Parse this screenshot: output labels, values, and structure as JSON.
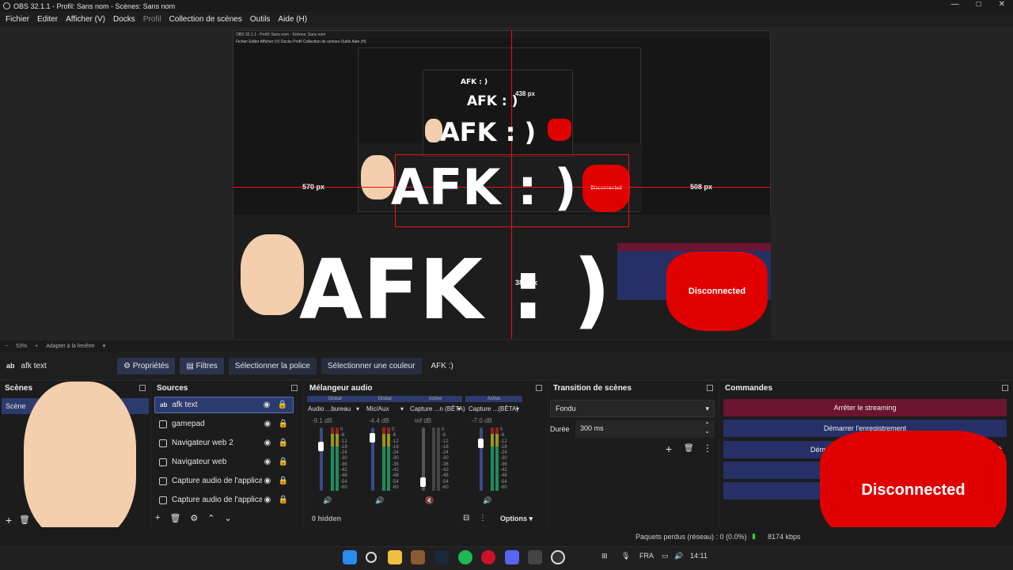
{
  "window": {
    "title": "OBS 32.1.1 - Profil: Sans nom - Scènes: Sans nom",
    "min": "—",
    "max": "□",
    "close": "✕"
  },
  "menu": [
    "Fichier",
    "Editer",
    "Afficher (V)",
    "Docks",
    "Profil",
    "Collection de scènes",
    "Outils",
    "Aide (H)"
  ],
  "preview": {
    "afk_text": "AFK : )",
    "guide_left": "570 px",
    "guide_right": "508 px",
    "guide_bottom": "386 px",
    "guide_top": "438 px",
    "gamepad_text": "Disconnected",
    "nested_title": "OBS 32.1.1 - Profil: Sans nom - Scènes: Sans nom",
    "nested_menu": "Fichier   Editer   Afficher (V)   Docks   Profil   Collection de scènes   Outils   Aide (H)"
  },
  "zoom": {
    "minus": "−",
    "value": "53%",
    "plus": "+",
    "fit": "Adapter à la fenêtre"
  },
  "source_toolbar": {
    "selected_name": "afk text",
    "properties": "Propriétés",
    "filters": "Filtres",
    "select_font": "Sélectionner la police",
    "select_color": "Sélectionner une couleur",
    "text_value": "AFK :)"
  },
  "scenes": {
    "title": "Scènes",
    "item": "Scène"
  },
  "sources": {
    "title": "Sources",
    "items": [
      "afk text",
      "gamepad",
      "Navigateur web 2",
      "Navigateur web",
      "Capture audio de l'applicatio",
      "Capture audio de l'applicatio"
    ]
  },
  "mixer": {
    "title": "Mélangeur audio",
    "tabs": [
      "Global",
      "Global",
      "Active",
      "Active"
    ],
    "channels": [
      {
        "name": "Audio ...bureau",
        "db": "-9.1 dB",
        "level": 0.75
      },
      {
        "name": "Mic/Aux",
        "db": "-4.4 dB",
        "level": 0.9
      },
      {
        "name": "Capture ...n (BÊTA)",
        "db": "-inf dB",
        "level": 0.1
      },
      {
        "name": "Capture ...(BÊTA)",
        "db": "-7.0 dB",
        "level": 0.8
      }
    ],
    "scale": [
      "0",
      "-6",
      "-12",
      "-18",
      "-24",
      "-30",
      "-36",
      "-42",
      "-48",
      "-54",
      "-60"
    ],
    "hidden": "0 hidden",
    "options": "Options"
  },
  "transition": {
    "title": "Transition de scènes",
    "type": "Fondu",
    "duration_label": "Durée",
    "duration": "300 ms"
  },
  "commands": {
    "title": "Commandes",
    "stop_stream": "Arrêter le streaming",
    "start_record": "Démarrer l'enregistrement",
    "start_vcam": "Démarrer",
    "gamepad_text": "Disconnected"
  },
  "status": {
    "dropped": "Paquets perdus (réseau) : 0 (0.0%)",
    "bitrate": "8174 kbps"
  },
  "taskbar": {
    "lang": "FRA",
    "time": "14:11"
  },
  "colors": {
    "accent": "#2c3b6e",
    "stop": "#6b1530",
    "gamepad": "#e00000",
    "guide": "#ee1111"
  }
}
